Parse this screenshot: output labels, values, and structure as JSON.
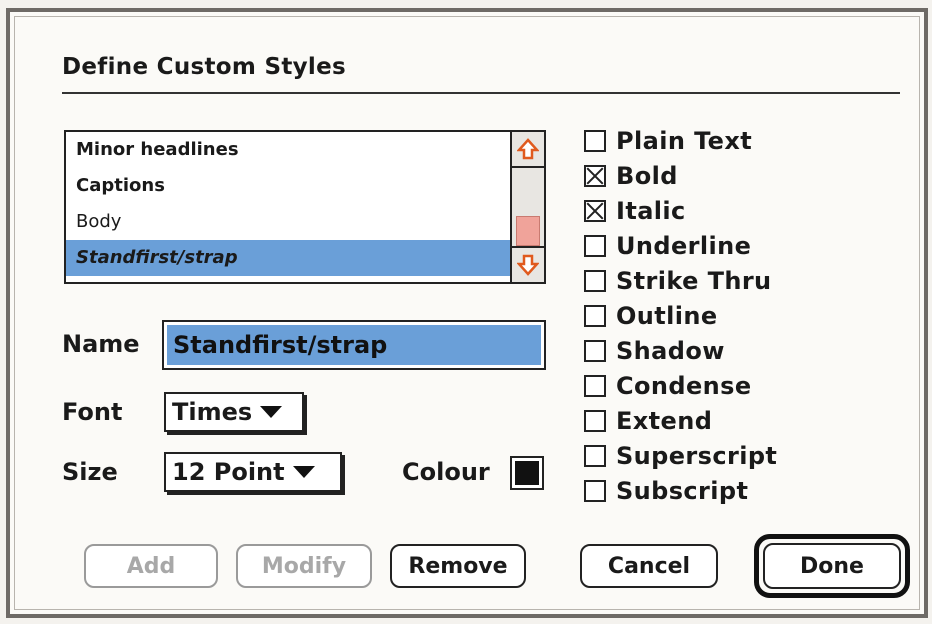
{
  "dialog": {
    "title": "Define Custom Styles"
  },
  "style_list": {
    "items": [
      {
        "label": "Minor headlines",
        "weight": "bold"
      },
      {
        "label": "Captions",
        "weight": "bold"
      },
      {
        "label": "Body",
        "weight": "normal"
      },
      {
        "label": "Standfirst/strap",
        "weight": "bold-italic",
        "selected": true
      }
    ],
    "selected_color": "#6a9fd8",
    "scroll_arrow_color": "#e05a1e"
  },
  "fields": {
    "name_label": "Name",
    "name_value": "Standfirst/strap",
    "font_label": "Font",
    "font_value": "Times",
    "size_label": "Size",
    "size_value": "12 Point",
    "colour_label": "Colour",
    "colour_value": "#111111"
  },
  "styles": [
    {
      "label": "Plain Text",
      "checked": false
    },
    {
      "label": "Bold",
      "checked": true
    },
    {
      "label": "Italic",
      "checked": true
    },
    {
      "label": "Underline",
      "checked": false
    },
    {
      "label": "Strike Thru",
      "checked": false
    },
    {
      "label": "Outline",
      "checked": false
    },
    {
      "label": "Shadow",
      "checked": false
    },
    {
      "label": "Condense",
      "checked": false
    },
    {
      "label": "Extend",
      "checked": false
    },
    {
      "label": "Superscript",
      "checked": false
    },
    {
      "label": "Subscript",
      "checked": false
    }
  ],
  "buttons": {
    "add": "Add",
    "modify": "Modify",
    "remove": "Remove",
    "cancel": "Cancel",
    "done": "Done"
  },
  "icons": {
    "scroll_up": "arrow-up-icon",
    "scroll_down": "arrow-down-icon",
    "popup_arrow": "triangle-down-icon"
  }
}
